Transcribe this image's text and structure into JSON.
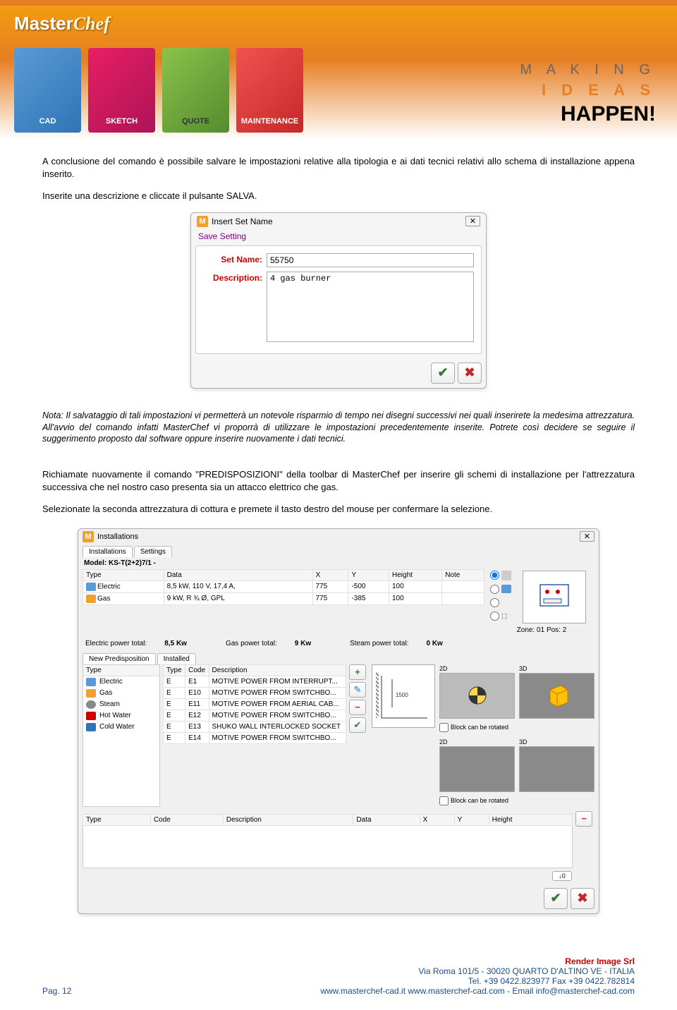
{
  "header": {
    "logo_main": "Master",
    "logo_sub": "Chef",
    "boxes": [
      "CAD",
      "SKETCH",
      "QUOTE",
      "MAINTENANCE"
    ],
    "tagline1": "M A K I N G",
    "tagline2": "I D E A S",
    "tagline3": "HAPPEN!"
  },
  "body": {
    "para1": "A conclusione del comando è possibile salvare le impostazioni relative alla tipologia e ai dati tecnici relativi allo schema di installazione appena inserito.",
    "para2": "Inserite una descrizione e cliccate il pulsante SALVA.",
    "note": "Nota: Il salvataggio di tali impostazioni vi permetterà un notevole risparmio di tempo nei disegni successivi nei quali inserirete la medesima attrezzatura. All'avvio del comando infatti MasterChef vi proporrà di utilizzare le impostazioni precedentemente inserite. Potrete così decidere se seguire il suggerimento proposto dal software oppure inserire nuovamente i dati tecnici.",
    "para3": "Richiamate nuovamente il comando \"PREDISPOSIZIONI\" della toolbar di MasterChef per inserire gli schemi di installazione per l'attrezzatura successiva che nel nostro caso presenta sia un attacco elettrico che gas.",
    "para4": "Selezionate la seconda attrezzatura di cottura e premete il tasto destro del mouse per confermare la selezione."
  },
  "dialog1": {
    "title": "Insert Set Name",
    "subtitle": "Save Setting",
    "setname_label": "Set Name:",
    "setname_value": "55750",
    "desc_label": "Description:",
    "desc_value": "4 gas burner"
  },
  "dialog2": {
    "title": "Installations",
    "tabs": [
      "Installations",
      "Settings"
    ],
    "model_label": "Model: KS-T(2+2)7/1 -",
    "cols": [
      "Type",
      "Data",
      "X",
      "Y",
      "Height",
      "Note"
    ],
    "rows": [
      {
        "type": "Electric",
        "data": "8,5 kW, 110 V, 17,4 A,",
        "x": "775",
        "y": "-500",
        "h": "100"
      },
      {
        "type": "Gas",
        "data": "9 kW, R ¾ Ø, GPL",
        "x": "775",
        "y": "-385",
        "h": "100"
      }
    ],
    "totals": {
      "elec_label": "Electric power total:",
      "elec_val": "8,5 Kw",
      "gas_label": "Gas power total:",
      "gas_val": "9 Kw",
      "steam_label": "Steam power total:",
      "steam_val": "0 Kw"
    },
    "zone_label": "Zone: 01 Pos: 2",
    "subtabs": [
      "New Predisposition",
      "Installed"
    ],
    "type_list_header": "Type",
    "type_list": [
      "Electric",
      "Gas",
      "Steam",
      "Hot Water",
      "Cold Water"
    ],
    "predis_cols": [
      "Type",
      "Code",
      "Description"
    ],
    "predis_rows": [
      {
        "t": "E",
        "c": "E1",
        "d": "MOTIVE POWER FROM INTERRUPT..."
      },
      {
        "t": "E",
        "c": "E10",
        "d": "MOTIVE POWER FROM SWITCHBO..."
      },
      {
        "t": "E",
        "c": "E11",
        "d": "MOTIVE POWER FROM AERIAL CAB..."
      },
      {
        "t": "E",
        "c": "E12",
        "d": "MOTIVE POWER FROM SWITCHBO..."
      },
      {
        "t": "E",
        "c": "E13",
        "d": "SHUKO WALL INTERLOCKED SOCKET"
      },
      {
        "t": "E",
        "c": "E14",
        "d": "MOTIVE POWER FROM SWITCHBO..."
      }
    ],
    "sel_cols": [
      "Type",
      "Code",
      "Description",
      "Data",
      "X",
      "Y",
      "Height"
    ],
    "coord_val": "0",
    "block_2d": "2D",
    "block_3d": "3D",
    "rotate_label": "Block can be rotated"
  },
  "footer": {
    "page": "Pag. 12",
    "company": "Render Image Srl",
    "addr": "Via Roma 101/5 - 30020 QUARTO D'ALTINO VE - ITALIA",
    "tel": "Tel. +39 0422.823977    Fax +39 0422.782814",
    "web": "www.masterchef-cad.it www.masterchef-cad.com - Email info@masterchef-cad.com"
  }
}
